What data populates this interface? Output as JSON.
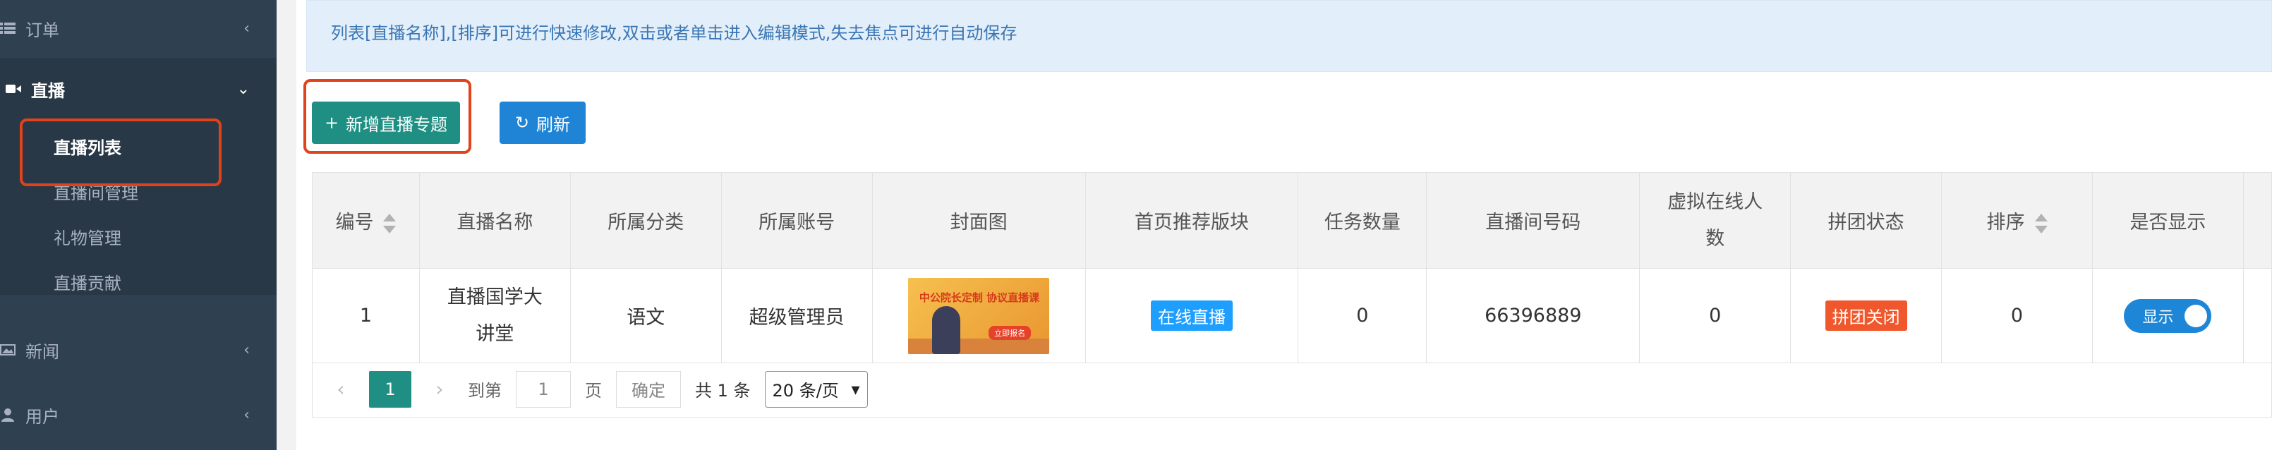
{
  "sidebar": {
    "orders": {
      "label": "订单",
      "icon": "list-icon"
    },
    "live": {
      "label": "直播",
      "icon": "video-camera-icon"
    },
    "live_sub": [
      "直播列表",
      "直播间管理",
      "礼物管理",
      "直播贡献"
    ],
    "news": {
      "label": "新闻",
      "icon": "image-icon"
    },
    "users": {
      "label": "用户",
      "icon": "user-icon"
    }
  },
  "notice": "列表[直播名称],[排序]可进行快速修改,双击或者单击进入编辑模式,失去焦点可进行自动保存",
  "toolbar": {
    "add_label": "新增直播专题",
    "refresh_label": "刷新"
  },
  "table": {
    "headers": [
      "编号",
      "直播名称",
      "所属分类",
      "所属账号",
      "封面图",
      "首页推荐版块",
      "任务数量",
      "直播间号码",
      "虚拟在线人数",
      "拼团状态",
      "排序",
      "是否显示"
    ],
    "rows": [
      {
        "id": "1",
        "name": "直播国学大讲堂",
        "category": "语文",
        "account": "超级管理员",
        "cover_text": "中公院长定制 协议直播课",
        "cover_tag": "立即报名",
        "recommend": "在线直播",
        "tasks": "0",
        "room_no": "66396889",
        "virtual_online": "0",
        "group_status": "拼团关闭",
        "sort": "0",
        "show": "显示"
      }
    ]
  },
  "pager": {
    "current": "1",
    "goto_label": "到第",
    "goto_value": "1",
    "page_label": "页",
    "confirm_label": "确定",
    "total": "共 1 条",
    "per_page": "20 条/页"
  },
  "colors": {
    "sidebar": "#2f4050",
    "primary": "#1f8f83",
    "blue": "#1f84d6",
    "highlight": "#e0431b"
  }
}
